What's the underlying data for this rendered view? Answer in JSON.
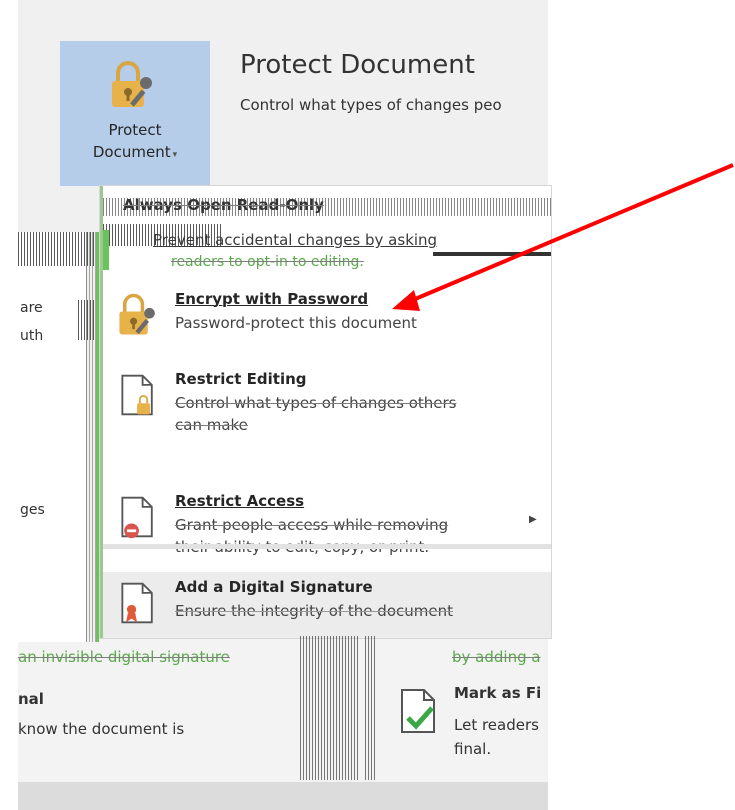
{
  "backstage": {
    "section_title": "Protect Document",
    "section_desc": "Control what types of changes peo",
    "protect_button": {
      "label_line1": "Protect",
      "label_line2": "Document",
      "icon": "lock-key-icon"
    }
  },
  "left_fragments": {
    "frag1": "are",
    "frag2": "uth",
    "frag3": "ges"
  },
  "menu": {
    "top_item": {
      "title": "Always Open Read-Only",
      "desc1": "Prevent accidental changes by asking",
      "desc2": "readers to opt-in to editing."
    },
    "items": [
      {
        "title": "Encrypt with Password",
        "desc1": "Password-protect this document",
        "icon": "lock-key-icon"
      },
      {
        "title": "Restrict Editing",
        "desc1": "Control what types of changes others",
        "desc2": "can make",
        "icon": "document-lock-icon"
      },
      {
        "title": "Restrict Access",
        "desc1": "Grant people access while removing",
        "desc2": "their ability to edit, copy, or print.",
        "icon": "document-block-icon"
      },
      {
        "title": "Add a Digital Signature",
        "desc1": "Ensure the integrity of the document",
        "icon": "document-ribbon-icon"
      }
    ]
  },
  "bottom_fragments": {
    "invisible_sig": "an invisible digital signature",
    "by_adding": "by adding a",
    "final_left": "nal",
    "know_doc": "know the document is",
    "mark_final_title": "Mark as Fi",
    "mark_final_desc1": "Let readers",
    "mark_final_desc2": "final."
  },
  "colors": {
    "button_bg": "#b5cde8",
    "arrow": "#ff0000",
    "lock_gold": "#e8b24a"
  }
}
